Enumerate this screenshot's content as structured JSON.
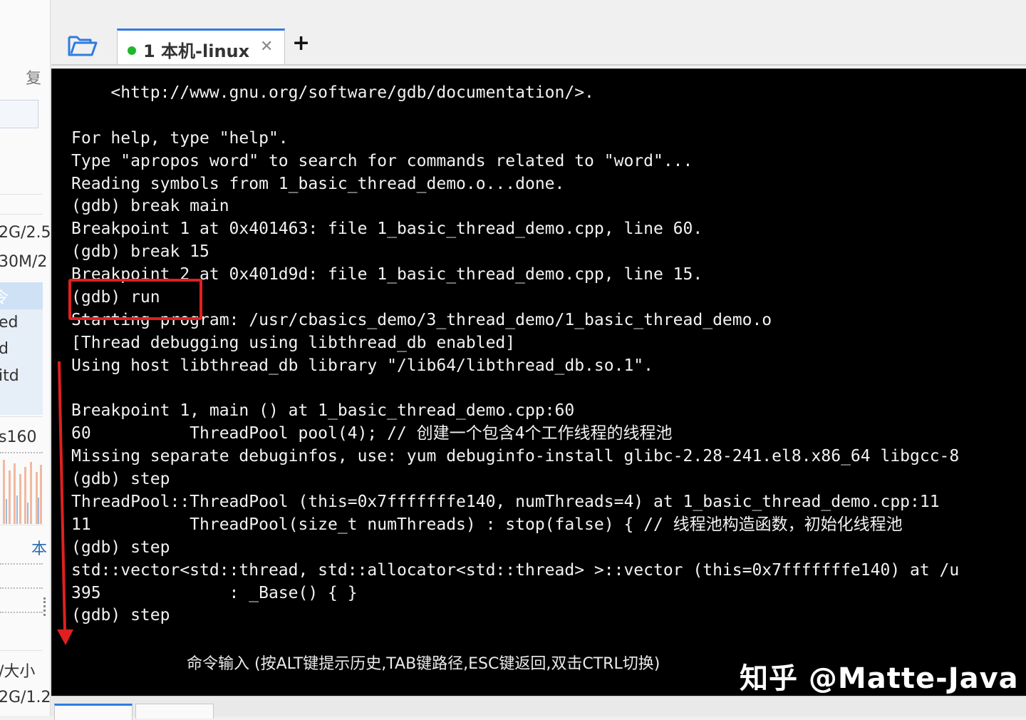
{
  "left_panel": {
    "copy_label": "复",
    "rows": [
      "2G/2.5",
      "30M/2",
      "令",
      "ed",
      "d",
      "itd",
      "s160",
      "/大小",
      "2G/1.2"
    ],
    "link_label": "本"
  },
  "tabs": [
    {
      "label": "1 本机-linux",
      "status_color": "#1fb82d",
      "active": true
    }
  ],
  "icons": {
    "folder": "folder-open-icon",
    "close": "close-icon",
    "add": "add-tab-icon"
  },
  "terminal": {
    "lines": [
      "    <http://www.gnu.org/software/gdb/documentation/>.",
      "",
      "For help, type \"help\".",
      "Type \"apropos word\" to search for commands related to \"word\"...",
      "Reading symbols from 1_basic_thread_demo.o...done.",
      "(gdb) break main",
      "Breakpoint 1 at 0x401463: file 1_basic_thread_demo.cpp, line 60.",
      "(gdb) break 15",
      "Breakpoint 2 at 0x401d9d: file 1_basic_thread_demo.cpp, line 15.",
      "(gdb) run",
      "Starting program: /usr/cbasics_demo/3_thread_demo/1_basic_thread_demo.o",
      "[Thread debugging using libthread_db enabled]",
      "Using host libthread_db library \"/lib64/libthread_db.so.1\".",
      "",
      "Breakpoint 1, main () at 1_basic_thread_demo.cpp:60",
      "60          ThreadPool pool(4); // 创建一个包含4个工作线程的线程池",
      "Missing separate debuginfos, use: yum debuginfo-install glibc-2.28-241.el8.x86_64 libgcc-8",
      "(gdb) step",
      "ThreadPool::ThreadPool (this=0x7fffffffe140, numThreads=4) at 1_basic_thread_demo.cpp:11",
      "11          ThreadPool(size_t numThreads) : stop(false) { // 线程池构造函数，初始化线程池",
      "(gdb) step",
      "std::vector<std::thread, std::allocator<std::thread> >::vector (this=0x7fffffffe140) at /u",
      "395             : _Base() { }",
      "(gdb) step"
    ],
    "command_hint": "命令输入 (按ALT键提示历史,TAB键路径,ESC键返回,双击CTRL切换)",
    "watermark": "知乎 @Matte-Java",
    "highlight_color": "#e02020"
  }
}
